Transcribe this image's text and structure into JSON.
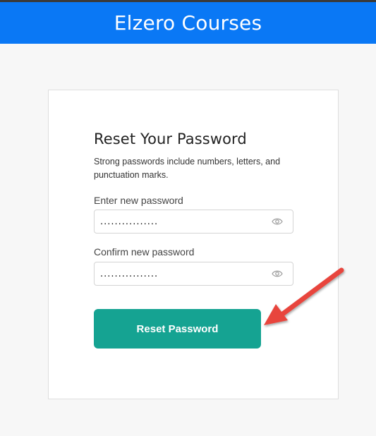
{
  "header": {
    "title": "Elzero Courses"
  },
  "form": {
    "title": "Reset Your Password",
    "description": "Strong passwords include numbers, letters, and punctuation marks.",
    "new_password": {
      "label": "Enter new password",
      "value": "................",
      "visibility_icon": "eye-icon"
    },
    "confirm_password": {
      "label": "Confirm new password",
      "value": "................",
      "visibility_icon": "eye-icon"
    },
    "submit_label": "Reset Password"
  },
  "colors": {
    "header_bg": "#0a78f5",
    "button_bg": "#15a392",
    "arrow": "#e8453c"
  }
}
